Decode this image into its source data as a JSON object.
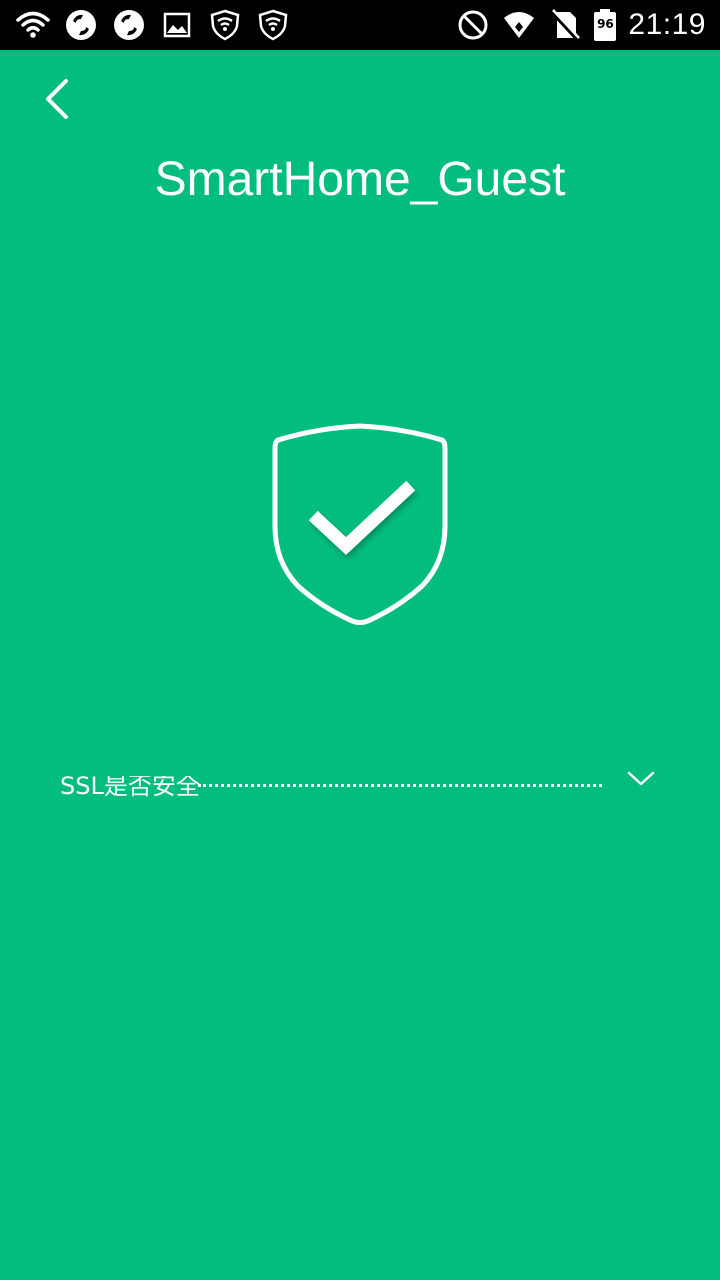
{
  "status_bar": {
    "time": "21:19",
    "battery_level": "96",
    "left_icons": [
      "wifi-icon",
      "sync-icon",
      "sync-icon",
      "image-icon",
      "shield-wifi-icon",
      "shield-wifi-icon"
    ],
    "right_icons": [
      "do-not-disturb-icon",
      "signal-icon",
      "no-sim-icon",
      "battery-icon"
    ]
  },
  "header": {
    "title": "SmartHome_Guest",
    "back_icon": "back-arrow-icon"
  },
  "status": {
    "icon": "shield-check-icon"
  },
  "checks": [
    {
      "label": "SSL是否安全",
      "icon": "chevron-down-icon"
    }
  ],
  "colors": {
    "background": "#03bd80",
    "status_bar": "#000000",
    "foreground": "#ffffff"
  }
}
